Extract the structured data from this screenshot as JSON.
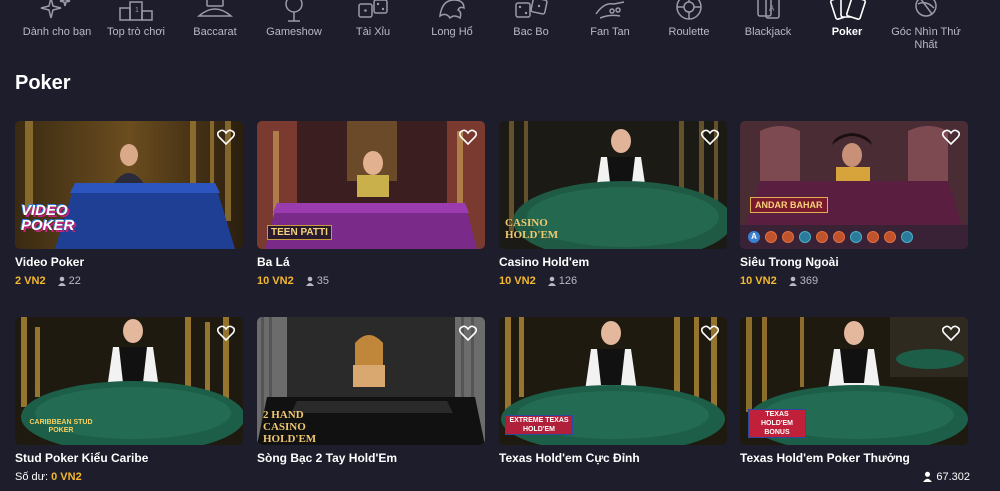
{
  "categories": [
    {
      "label": "Dành cho bạn",
      "icon": "sparkles-icon"
    },
    {
      "label": "Top trò chơi",
      "icon": "podium-icon"
    },
    {
      "label": "Baccarat",
      "icon": "baccarat-table-icon"
    },
    {
      "label": "Gameshow",
      "icon": "microphone-icon"
    },
    {
      "label": "Tài Xỉu",
      "icon": "dice-icon"
    },
    {
      "label": "Long Hổ",
      "icon": "dragon-icon"
    },
    {
      "label": "Bac Bo",
      "icon": "dice-pair-icon"
    },
    {
      "label": "Fan Tan",
      "icon": "fan-tan-hand-icon"
    },
    {
      "label": "Roulette",
      "icon": "roulette-wheel-icon"
    },
    {
      "label": "Blackjack",
      "icon": "playing-cards-icon"
    },
    {
      "label": "Poker",
      "icon": "poker-cards-icon",
      "active": true
    },
    {
      "label": "Góc Nhìn Thứ Nhất",
      "icon": "first-person-view-icon"
    }
  ],
  "section_title": "Poker",
  "games": [
    {
      "title": "Video Poker",
      "bet": "2 VN2",
      "players": "22",
      "logo": "VIDEO POKER"
    },
    {
      "title": "Ba Lá",
      "bet": "10 VN2",
      "players": "35",
      "logo": "TEEN PATTI"
    },
    {
      "title": "Casino Hold'em",
      "bet": "10 VN2",
      "players": "126",
      "logo": "CASINO HOLD'EM"
    },
    {
      "title": "Siêu Trong Ngoài",
      "bet": "10 VN2",
      "players": "369",
      "logo": "ANDAR BAHAR",
      "badge": "A"
    },
    {
      "title": "Stud Poker Kiểu Caribe",
      "logo": "CARIBBEAN STUD POKER"
    },
    {
      "title": "Sòng Bạc 2 Tay Hold'Em",
      "logo": "2 HAND CASINO HOLD'EM"
    },
    {
      "title": "Texas Hold'em Cực Đỉnh",
      "logo": "EXTREME TEXAS HOLD'EM"
    },
    {
      "title": "Texas Hold'em Poker Thưởng",
      "logo": "TEXAS HOLD'EM BONUS"
    }
  ],
  "footer": {
    "balance_label": "Số dư:",
    "balance_value": "0 VN2",
    "online_count": "67.302"
  },
  "colors": {
    "accent": "#f5b82e",
    "background": "#1d1d2b",
    "muted": "#b8b9c6"
  }
}
